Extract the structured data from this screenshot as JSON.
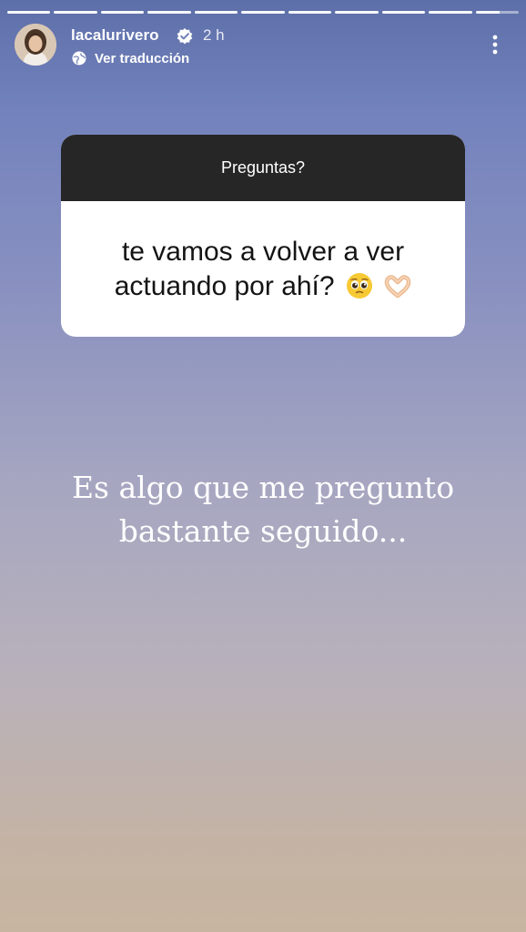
{
  "story": {
    "progress_segments_total": 11,
    "progress_current_segment": 11,
    "progress_current_fraction": 0.55
  },
  "header": {
    "username": "lacalurivero",
    "verified": true,
    "time_ago": "2 h",
    "translate_label": "Ver traducción"
  },
  "question_sticker": {
    "title": "Preguntas?",
    "question": "te vamos a volver a ver actuando por ahí?",
    "emojis": [
      "pleading-face",
      "heart-hands"
    ]
  },
  "caption": {
    "line1": "Es algo que me pregunto",
    "line2": "bastante seguido..."
  },
  "colors": {
    "sticker_header": "#262626",
    "background_top": "#5d6fa8",
    "background_bottom": "#c8b5a1"
  },
  "icons": {
    "verified": "verified-badge-icon",
    "translate": "globe-icon",
    "more": "more-vertical-icon"
  }
}
